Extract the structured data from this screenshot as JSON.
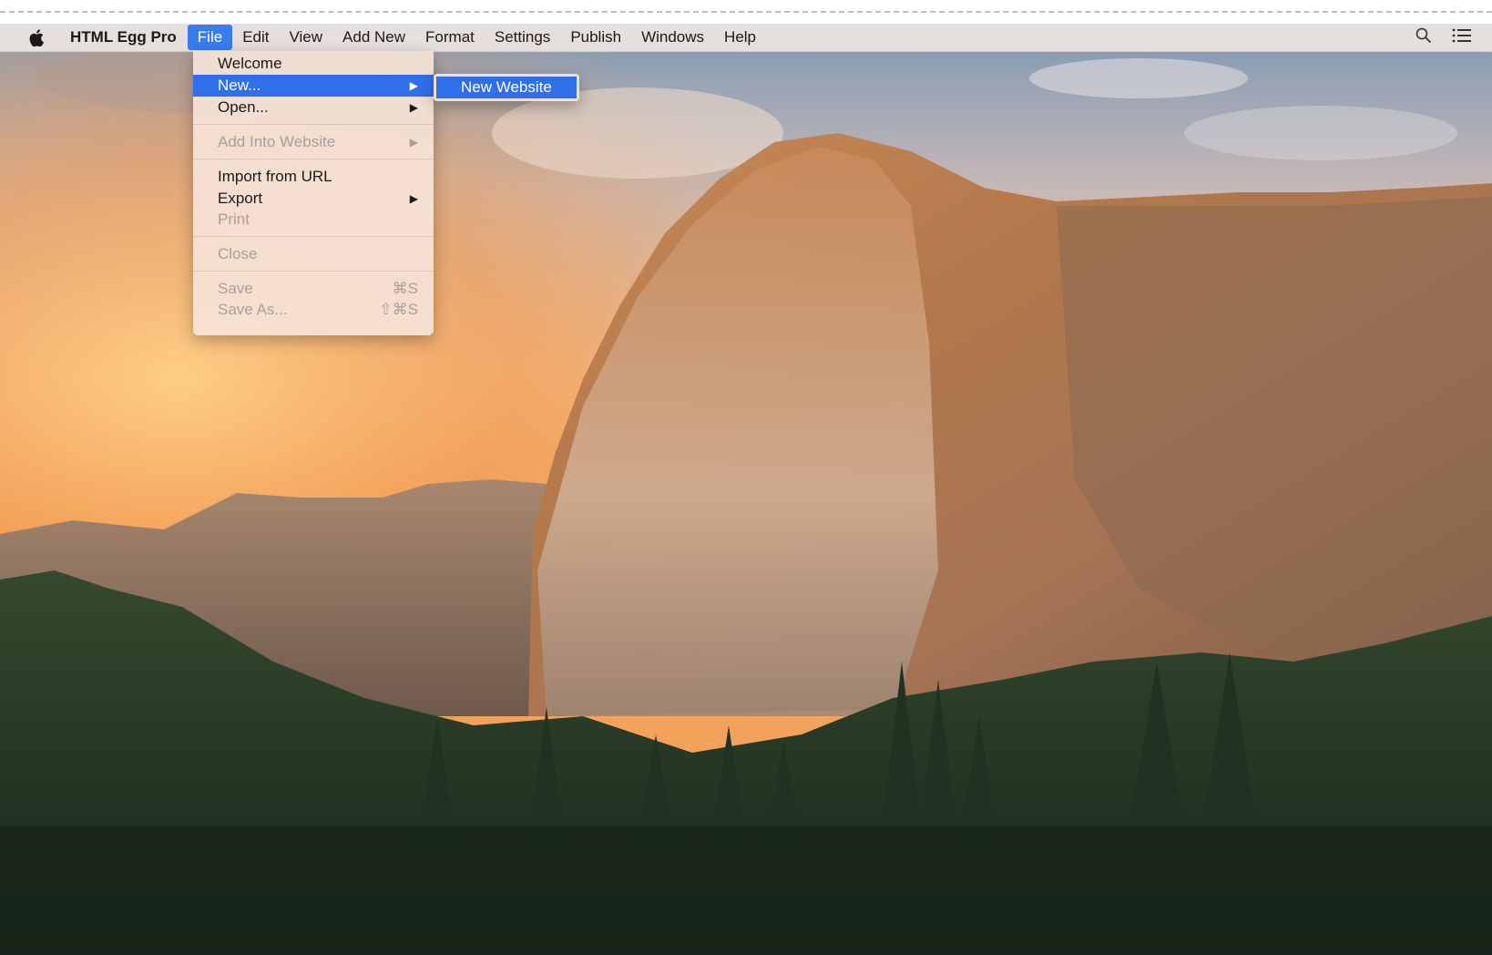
{
  "menubar": {
    "apple_icon": "apple-icon",
    "app_name": "HTML Egg Pro",
    "items": [
      {
        "label": "File",
        "active": true
      },
      {
        "label": "Edit"
      },
      {
        "label": "View"
      },
      {
        "label": "Add New"
      },
      {
        "label": "Format"
      },
      {
        "label": "Settings"
      },
      {
        "label": "Publish"
      },
      {
        "label": "Windows"
      },
      {
        "label": "Help"
      }
    ],
    "right_icons": [
      "search-icon",
      "list-icon"
    ],
    "active_color": "#3a7bf0"
  },
  "file_menu": {
    "items": [
      {
        "label": "Welcome",
        "enabled": true
      },
      {
        "label": "New...",
        "enabled": true,
        "submenu": true,
        "highlighted": true
      },
      {
        "label": "Open...",
        "enabled": true,
        "submenu": true
      },
      {
        "label": "Add Into Website",
        "enabled": false,
        "submenu": true
      },
      {
        "label": "Import from URL",
        "enabled": true
      },
      {
        "label": "Export",
        "enabled": true,
        "submenu": true
      },
      {
        "label": "Print",
        "enabled": false
      },
      {
        "label": "Close",
        "enabled": false
      },
      {
        "label": "Save",
        "enabled": false,
        "shortcut": "⌘S"
      },
      {
        "label": "Save As...",
        "enabled": false,
        "shortcut": "⇧⌘S"
      }
    ],
    "highlight_color": "#2f6fe9"
  },
  "new_submenu": {
    "items": [
      {
        "label": "New Website",
        "highlighted": true
      }
    ]
  },
  "desktop": {
    "wallpaper": "mountain-landscape"
  }
}
